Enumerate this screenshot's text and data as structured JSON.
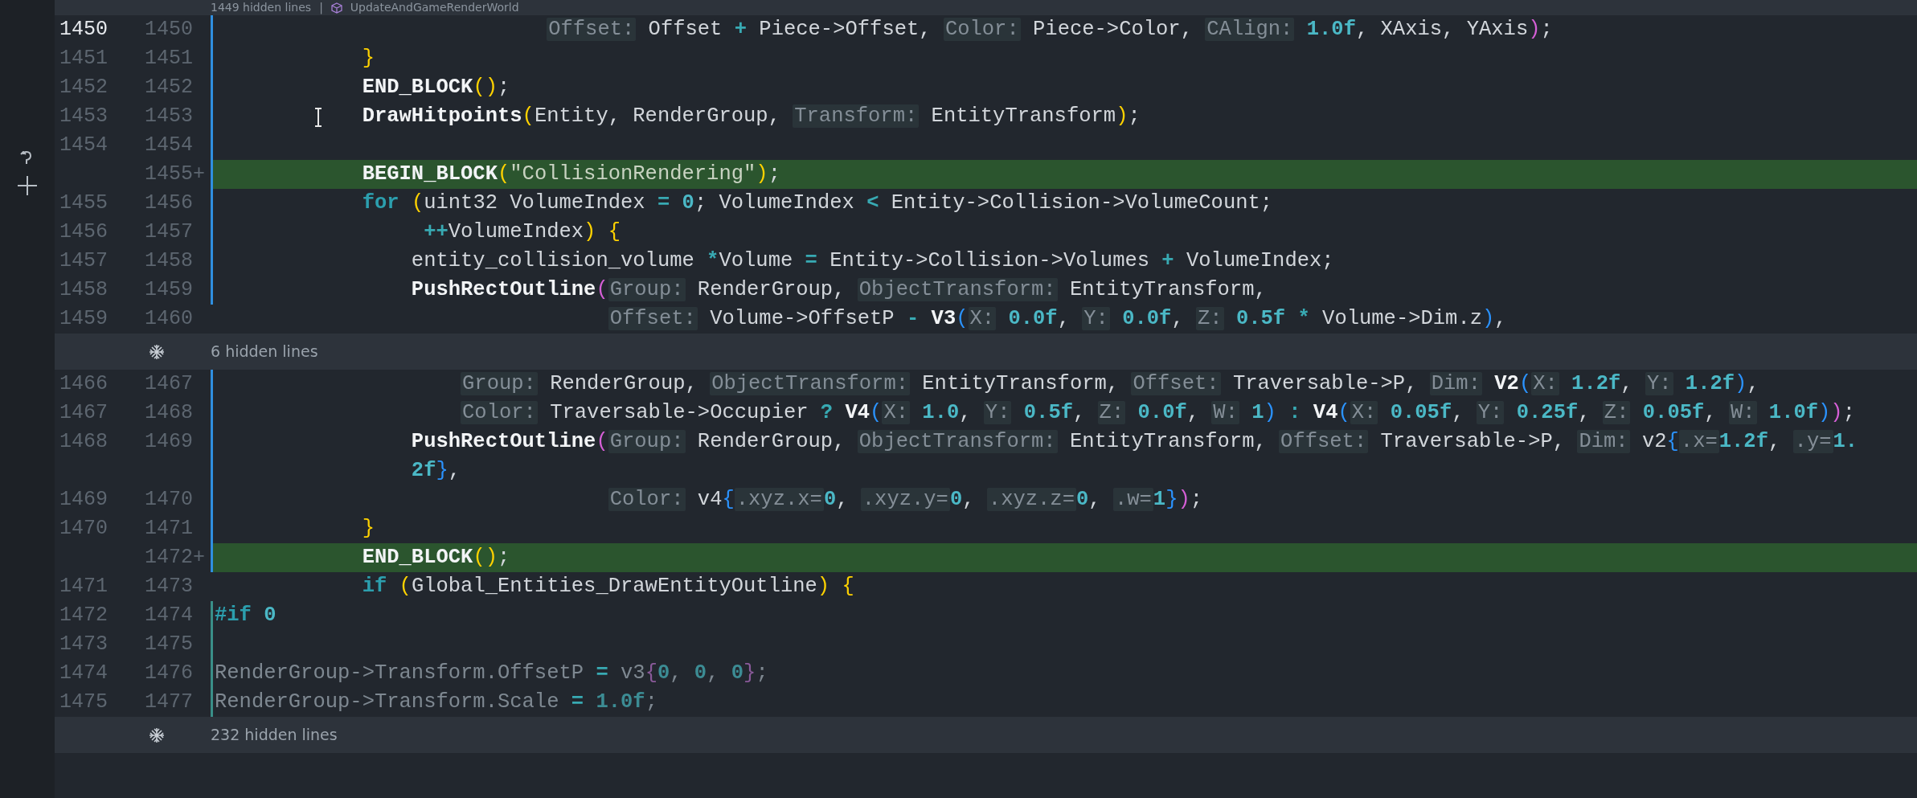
{
  "top_fold": {
    "label": "1449 hidden lines",
    "separator": "|",
    "context": "UpdateAndGameRenderWorld"
  },
  "rows": [
    {
      "kind": "line",
      "old": "1450",
      "new": "1450",
      "current": true,
      "added": false,
      "modified": true,
      "inactive": false,
      "tokens": [
        {
          "kind": "hint",
          "text": "                           Offset:"
        },
        {
          "kind": "text",
          "text": " Offset "
        },
        {
          "kind": "op",
          "text": "+"
        },
        {
          "kind": "text",
          "text": " Piece->Offset, "
        },
        {
          "kind": "hint",
          "text": "Color:"
        },
        {
          "kind": "text",
          "text": " Piece->Color, "
        },
        {
          "kind": "hint",
          "text": "CAlign:"
        },
        {
          "kind": "num",
          "text": " 1.0f"
        },
        {
          "kind": "text",
          "text": ", XAxis, YAxis"
        },
        {
          "kind": "b2",
          "text": ")"
        },
        {
          "kind": "text",
          "text": ";"
        }
      ]
    },
    {
      "kind": "line",
      "old": "1451",
      "new": "1451",
      "current": false,
      "added": false,
      "modified": true,
      "inactive": false,
      "tokens": [
        {
          "kind": "b1",
          "text": "            }"
        }
      ]
    },
    {
      "kind": "line",
      "old": "1452",
      "new": "1452",
      "current": false,
      "added": false,
      "modified": true,
      "inactive": false,
      "tokens": [
        {
          "kind": "fn",
          "text": "            END_BLOCK"
        },
        {
          "kind": "b1",
          "text": "()"
        },
        {
          "kind": "text",
          "text": ";"
        }
      ]
    },
    {
      "kind": "line",
      "old": "1453",
      "new": "1453",
      "current": false,
      "added": false,
      "modified": true,
      "inactive": false,
      "tokens": [
        {
          "kind": "fn",
          "text": "            DrawHitpoints"
        },
        {
          "kind": "b1",
          "text": "("
        },
        {
          "kind": "text",
          "text": "Entity, RenderGroup, "
        },
        {
          "kind": "hint",
          "text": "Transform:"
        },
        {
          "kind": "text",
          "text": " EntityTransform"
        },
        {
          "kind": "b1",
          "text": ")"
        },
        {
          "kind": "text",
          "text": ";"
        }
      ]
    },
    {
      "kind": "line",
      "old": "1454",
      "new": "1454",
      "current": false,
      "added": false,
      "modified": true,
      "inactive": false
    },
    {
      "kind": "line",
      "new": "1455",
      "sign": "+",
      "current": false,
      "added": true,
      "modified": true,
      "inactive": false,
      "tokens": [
        {
          "kind": "fn",
          "text": "            BEGIN_BLOCK"
        },
        {
          "kind": "b1",
          "text": "("
        },
        {
          "kind": "str",
          "text": "\"CollisionRendering\""
        },
        {
          "kind": "b1",
          "text": ")"
        },
        {
          "kind": "text",
          "text": ";"
        }
      ]
    },
    {
      "kind": "line",
      "old": "1455",
      "new": "1456",
      "current": false,
      "added": false,
      "modified": true,
      "inactive": false,
      "tokens": [
        {
          "kind": "kw",
          "text": "            for"
        },
        {
          "kind": "b1",
          "text": " ("
        },
        {
          "kind": "text",
          "text": "uint32 VolumeIndex "
        },
        {
          "kind": "op",
          "text": "="
        },
        {
          "kind": "num",
          "text": " 0"
        },
        {
          "kind": "text",
          "text": "; VolumeIndex "
        },
        {
          "kind": "op",
          "text": "<"
        },
        {
          "kind": "text",
          "text": " Entity->Collision->VolumeCount;"
        }
      ]
    },
    {
      "kind": "line",
      "old": "1456",
      "new": "1457",
      "current": false,
      "added": false,
      "modified": true,
      "inactive": false,
      "tokens": [
        {
          "kind": "op",
          "text": "                 ++"
        },
        {
          "kind": "text",
          "text": "VolumeIndex"
        },
        {
          "kind": "b1",
          "text": ")"
        },
        {
          "kind": "b1",
          "text": " {"
        }
      ]
    },
    {
      "kind": "line",
      "old": "1457",
      "new": "1458",
      "current": false,
      "added": false,
      "modified": true,
      "inactive": false,
      "tokens": [
        {
          "kind": "text",
          "text": "                entity_collision_volume "
        },
        {
          "kind": "op",
          "text": "*"
        },
        {
          "kind": "text",
          "text": "Volume "
        },
        {
          "kind": "op",
          "text": "="
        },
        {
          "kind": "text",
          "text": " Entity->Collision->Volumes "
        },
        {
          "kind": "op",
          "text": "+"
        },
        {
          "kind": "text",
          "text": " VolumeIndex;"
        }
      ]
    },
    {
      "kind": "line",
      "old": "1458",
      "new": "1459",
      "current": false,
      "added": false,
      "modified": true,
      "inactive": false,
      "tokens": [
        {
          "kind": "fn",
          "text": "                PushRectOutline"
        },
        {
          "kind": "b2",
          "text": "("
        },
        {
          "kind": "hint",
          "text": "Group:"
        },
        {
          "kind": "text",
          "text": " RenderGroup, "
        },
        {
          "kind": "hint",
          "text": "ObjectTransform:"
        },
        {
          "kind": "text",
          "text": " EntityTransform,"
        }
      ]
    },
    {
      "kind": "line",
      "old": "1459",
      "new": "1460",
      "current": false,
      "added": false,
      "modified": false,
      "inactive": false,
      "tokens": [
        {
          "kind": "hint",
          "text": "                                Offset:"
        },
        {
          "kind": "text",
          "text": " Volume->OffsetP "
        },
        {
          "kind": "op",
          "text": "-"
        },
        {
          "kind": "fn",
          "text": " V3"
        },
        {
          "kind": "b3",
          "text": "("
        },
        {
          "kind": "hint",
          "text": "X:"
        },
        {
          "kind": "num",
          "text": " 0.0f"
        },
        {
          "kind": "text",
          "text": ", "
        },
        {
          "kind": "hint",
          "text": "Y:"
        },
        {
          "kind": "num",
          "text": " 0.0f"
        },
        {
          "kind": "text",
          "text": ", "
        },
        {
          "kind": "hint",
          "text": "Z:"
        },
        {
          "kind": "num",
          "text": " 0.5f"
        },
        {
          "kind": "op",
          "text": " *"
        },
        {
          "kind": "text",
          "text": " Volume->Dim.z"
        },
        {
          "kind": "b3",
          "text": ")"
        },
        {
          "kind": "text",
          "text": ","
        }
      ]
    },
    {
      "kind": "fold",
      "label": "6 hidden lines"
    },
    {
      "kind": "line",
      "old": "1466",
      "new": "1467",
      "current": false,
      "added": false,
      "modified": true,
      "inactive": false,
      "tokens": [
        {
          "kind": "hint",
          "text": "                    Group:"
        },
        {
          "kind": "text",
          "text": " RenderGroup, "
        },
        {
          "kind": "hint",
          "text": "ObjectTransform:"
        },
        {
          "kind": "text",
          "text": " EntityTransform, "
        },
        {
          "kind": "hint",
          "text": "Offset:"
        },
        {
          "kind": "text",
          "text": " Traversable->P, "
        },
        {
          "kind": "hint",
          "text": "Dim:"
        },
        {
          "kind": "fn",
          "text": " V2"
        },
        {
          "kind": "b3",
          "text": "("
        },
        {
          "kind": "hint",
          "text": "X:"
        },
        {
          "kind": "num",
          "text": " 1.2f"
        },
        {
          "kind": "text",
          "text": ", "
        },
        {
          "kind": "hint",
          "text": "Y:"
        },
        {
          "kind": "num",
          "text": " 1.2f"
        },
        {
          "kind": "b3",
          "text": ")"
        },
        {
          "kind": "text",
          "text": ","
        }
      ]
    },
    {
      "kind": "line",
      "old": "1467",
      "new": "1468",
      "current": false,
      "added": false,
      "modified": true,
      "inactive": false,
      "tokens": [
        {
          "kind": "hint",
          "text": "                    Color:"
        },
        {
          "kind": "text",
          "text": " Traversable->Occupier "
        },
        {
          "kind": "op",
          "text": "?"
        },
        {
          "kind": "fn",
          "text": " V4"
        },
        {
          "kind": "b3",
          "text": "("
        },
        {
          "kind": "hint",
          "text": "X:"
        },
        {
          "kind": "num",
          "text": " 1.0"
        },
        {
          "kind": "text",
          "text": ", "
        },
        {
          "kind": "hint",
          "text": "Y:"
        },
        {
          "kind": "num",
          "text": " 0.5f"
        },
        {
          "kind": "text",
          "text": ", "
        },
        {
          "kind": "hint",
          "text": "Z:"
        },
        {
          "kind": "num",
          "text": " 0.0f"
        },
        {
          "kind": "text",
          "text": ", "
        },
        {
          "kind": "hint",
          "text": "W:"
        },
        {
          "kind": "num",
          "text": " 1"
        },
        {
          "kind": "b3",
          "text": ")"
        },
        {
          "kind": "op",
          "text": " :"
        },
        {
          "kind": "fn",
          "text": " V4"
        },
        {
          "kind": "b3",
          "text": "("
        },
        {
          "kind": "hint",
          "text": "X:"
        },
        {
          "kind": "num",
          "text": " 0.05f"
        },
        {
          "kind": "text",
          "text": ", "
        },
        {
          "kind": "hint",
          "text": "Y:"
        },
        {
          "kind": "num",
          "text": " 0.25f"
        },
        {
          "kind": "text",
          "text": ", "
        },
        {
          "kind": "hint",
          "text": "Z:"
        },
        {
          "kind": "num",
          "text": " 0.05f"
        },
        {
          "kind": "text",
          "text": ", "
        },
        {
          "kind": "hint",
          "text": "W:"
        },
        {
          "kind": "num",
          "text": " 1.0f"
        },
        {
          "kind": "b3",
          "text": ")"
        },
        {
          "kind": "b2",
          "text": ")"
        },
        {
          "kind": "text",
          "text": ";"
        }
      ]
    },
    {
      "kind": "line",
      "old": "1468",
      "new": "1469",
      "current": false,
      "added": false,
      "modified": true,
      "inactive": false,
      "tokens": [
        {
          "kind": "fn",
          "text": "                PushRectOutline"
        },
        {
          "kind": "b2",
          "text": "("
        },
        {
          "kind": "hint",
          "text": "Group:"
        },
        {
          "kind": "text",
          "text": " RenderGroup, "
        },
        {
          "kind": "hint",
          "text": "ObjectTransform:"
        },
        {
          "kind": "text",
          "text": " EntityTransform, "
        },
        {
          "kind": "hint",
          "text": "Offset:"
        },
        {
          "kind": "text",
          "text": " Traversable->P, "
        },
        {
          "kind": "hint",
          "text": "Dim:"
        },
        {
          "kind": "text",
          "text": " v2"
        },
        {
          "kind": "b3",
          "text": "{"
        },
        {
          "kind": "hint",
          "text": ".x="
        },
        {
          "kind": "num",
          "text": "1.2f"
        },
        {
          "kind": "text",
          "text": ", "
        },
        {
          "kind": "hint",
          "text": ".y="
        },
        {
          "kind": "num",
          "text": "1."
        }
      ]
    },
    {
      "kind": "line",
      "added": false,
      "modified": true,
      "inactive": false,
      "tokens": [
        {
          "kind": "num",
          "text": "                2f"
        },
        {
          "kind": "b3",
          "text": "}"
        },
        {
          "kind": "text",
          "text": ","
        }
      ]
    },
    {
      "kind": "line",
      "old": "1469",
      "new": "1470",
      "current": false,
      "added": false,
      "modified": true,
      "inactive": false,
      "tokens": [
        {
          "kind": "hint",
          "text": "                                Color:"
        },
        {
          "kind": "text",
          "text": " v4"
        },
        {
          "kind": "b3",
          "text": "{"
        },
        {
          "kind": "hint",
          "text": ".xyz.x="
        },
        {
          "kind": "num",
          "text": "0"
        },
        {
          "kind": "text",
          "text": ", "
        },
        {
          "kind": "hint",
          "text": ".xyz.y="
        },
        {
          "kind": "num",
          "text": "0"
        },
        {
          "kind": "text",
          "text": ", "
        },
        {
          "kind": "hint",
          "text": ".xyz.z="
        },
        {
          "kind": "num",
          "text": "0"
        },
        {
          "kind": "text",
          "text": ", "
        },
        {
          "kind": "hint",
          "text": ".w="
        },
        {
          "kind": "num",
          "text": "1"
        },
        {
          "kind": "b3",
          "text": "}"
        },
        {
          "kind": "b2",
          "text": ")"
        },
        {
          "kind": "text",
          "text": ";"
        }
      ]
    },
    {
      "kind": "line",
      "old": "1470",
      "new": "1471",
      "current": false,
      "added": false,
      "modified": true,
      "inactive": false,
      "tokens": [
        {
          "kind": "b1",
          "text": "            }"
        }
      ]
    },
    {
      "kind": "line",
      "new": "1472",
      "sign": "+",
      "current": false,
      "added": true,
      "modified": true,
      "inactive": false,
      "tokens": [
        {
          "kind": "fn",
          "text": "            END_BLOCK"
        },
        {
          "kind": "b1",
          "text": "()"
        },
        {
          "kind": "text",
          "text": ";"
        }
      ]
    },
    {
      "kind": "line",
      "old": "1471",
      "new": "1473",
      "current": false,
      "added": false,
      "modified": false,
      "inactive": false,
      "tokens": [
        {
          "kind": "kw",
          "text": "            if"
        },
        {
          "kind": "b1",
          "text": " ("
        },
        {
          "kind": "text",
          "text": "Global_Entities_DrawEntityOutline"
        },
        {
          "kind": "b1",
          "text": ")"
        },
        {
          "kind": "b1",
          "text": " {"
        }
      ]
    },
    {
      "kind": "line",
      "old": "1472",
      "new": "1474",
      "current": false,
      "added": false,
      "modified": false,
      "inactive": true,
      "tokens": [
        {
          "kind": "kw",
          "text": "#if"
        },
        {
          "kind": "num",
          "text": " 0"
        }
      ]
    },
    {
      "kind": "line",
      "old": "1473",
      "new": "1475",
      "current": false,
      "added": false,
      "modified": false,
      "inactive": true
    },
    {
      "kind": "line",
      "old": "1474",
      "new": "1476",
      "current": false,
      "added": false,
      "modified": false,
      "inactive": true,
      "tokens": [
        {
          "kind": "dim",
          "text": "RenderGroup->Transform.OffsetP "
        },
        {
          "kind": "op",
          "text": "="
        },
        {
          "kind": "dim",
          "text": " v3"
        },
        {
          "kind": "dimb",
          "text": "{"
        },
        {
          "kind": "dimnum",
          "text": "0"
        },
        {
          "kind": "dim",
          "text": ", "
        },
        {
          "kind": "dimnum",
          "text": "0"
        },
        {
          "kind": "dim",
          "text": ", "
        },
        {
          "kind": "dimnum",
          "text": "0"
        },
        {
          "kind": "dimb",
          "text": "}"
        },
        {
          "kind": "dim",
          "text": ";"
        }
      ]
    },
    {
      "kind": "line",
      "old": "1475",
      "new": "1477",
      "current": false,
      "added": false,
      "modified": false,
      "inactive": true,
      "tokens": [
        {
          "kind": "dim",
          "text": "RenderGroup->Transform.Scale "
        },
        {
          "kind": "op",
          "text": "="
        },
        {
          "kind": "dimnum",
          "text": " 1.0f"
        },
        {
          "kind": "dim",
          "text": ";"
        }
      ]
    },
    {
      "kind": "fold",
      "label": "232 hidden lines"
    }
  ]
}
